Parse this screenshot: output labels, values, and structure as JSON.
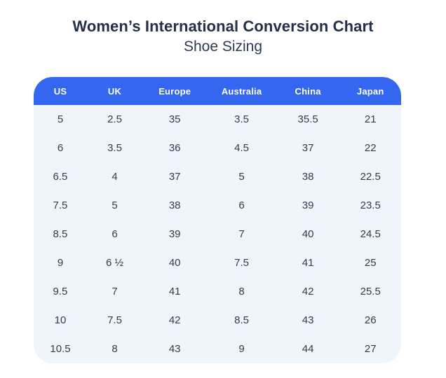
{
  "page": {
    "title": "Women’s International Conversion Chart",
    "subtitle": "Shoe Sizing"
  },
  "colors": {
    "header_bg": "#3566EF",
    "body_bg": "#F0F4FB",
    "title_text": "#252F48",
    "subtitle_text": "#2E3A52",
    "cell_text": "#333B4D",
    "header_text": "#FFFFFF",
    "page_bg": "#FFFFFF"
  },
  "chart_data": {
    "type": "table",
    "title": "Women’s International Conversion Chart",
    "subtitle": "Shoe Sizing",
    "columns": [
      "US",
      "UK",
      "Europe",
      "Australia",
      "China",
      "Japan"
    ],
    "rows": [
      [
        "5",
        "2.5",
        "35",
        "3.5",
        "35.5",
        "21"
      ],
      [
        "6",
        "3.5",
        "36",
        "4.5",
        "37",
        "22"
      ],
      [
        "6.5",
        "4",
        "37",
        "5",
        "38",
        "22.5"
      ],
      [
        "7.5",
        "5",
        "38",
        "6",
        "39",
        "23.5"
      ],
      [
        "8.5",
        "6",
        "39",
        "7",
        "40",
        "24.5"
      ],
      [
        "9",
        "6 ½",
        "40",
        "7.5",
        "41",
        "25"
      ],
      [
        "9.5",
        "7",
        "41",
        "8",
        "42",
        "25.5"
      ],
      [
        "10",
        "7.5",
        "42",
        "8.5",
        "43",
        "26"
      ],
      [
        "10.5",
        "8",
        "43",
        "9",
        "44",
        "27"
      ]
    ],
    "layout": {
      "legend": "none",
      "grid": "off",
      "column_width_percents": [
        14.5,
        15.1,
        17.6,
        18.8,
        17.3,
        16.7
      ]
    }
  }
}
